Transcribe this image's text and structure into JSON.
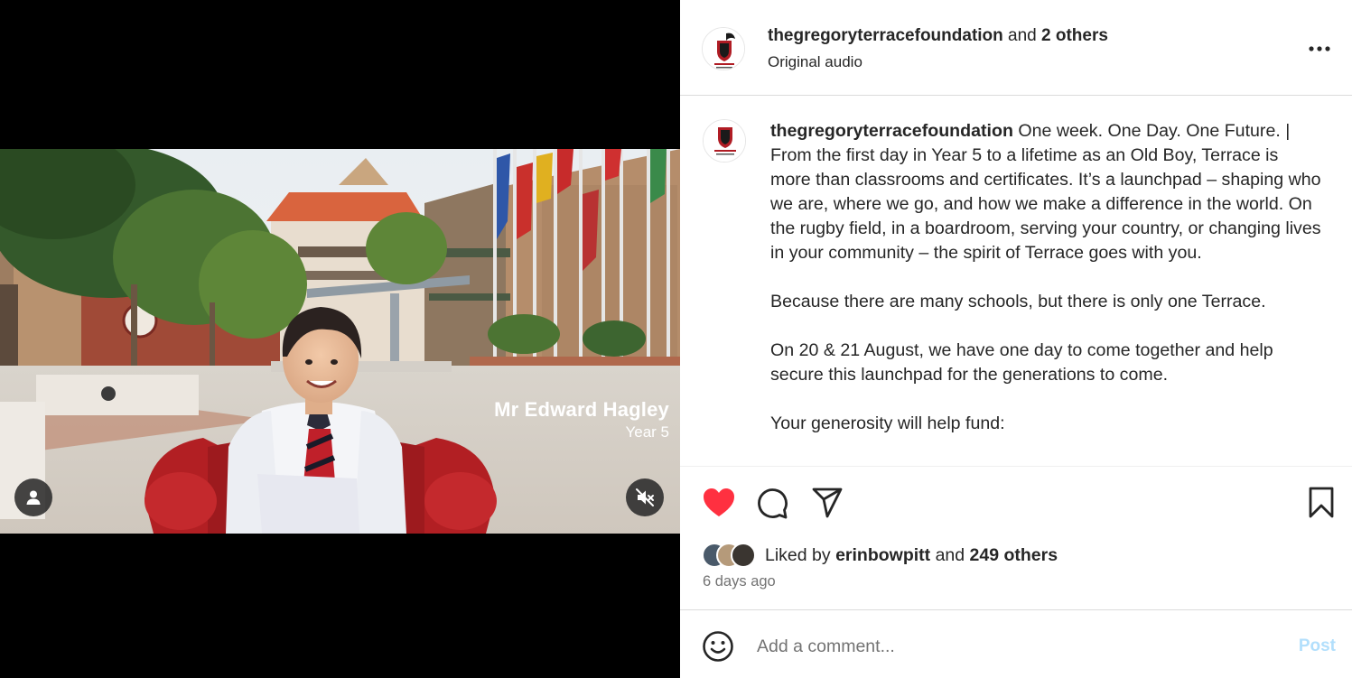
{
  "video": {
    "lower_third_name": "Mr Edward Hagley",
    "lower_third_subtitle": "Year 5",
    "tag_users_icon": "user-icon",
    "mute_icon": "muted-speaker-icon"
  },
  "header": {
    "username": "thegregoryterracefoundation",
    "connector": "and",
    "others": "2 others",
    "audio": "Original audio",
    "more_icon": "more-horizontal-icon",
    "more_label": "•••"
  },
  "caption": {
    "username": "thegregoryterracefoundation",
    "paragraph1": "One week. One Day. One Future. | From the first day in Year 5 to a lifetime as an Old Boy, Terrace is more than classrooms and certificates. It’s a launchpad – shaping who we are, where we go, and how we make a difference in the world. On the rugby field, in a boardroom, serving your country, or changing lives in your community – the spirit of Terrace goes with you.",
    "paragraph2": "Because there are many schools, but there is only one Terrace.",
    "paragraph3": "On 20 & 21 August, we have one day to come together and help secure this launchpad for the generations to come.",
    "paragraph4": "Your generosity will help fund:"
  },
  "actions": {
    "like_icon": "heart-filled-icon",
    "comment_icon": "comment-icon",
    "share_icon": "share-icon",
    "save_icon": "bookmark-icon",
    "like_color": "#ff3040"
  },
  "likes": {
    "prefix": "Liked by",
    "user": "erinbowpitt",
    "connector": "and",
    "others": "249 others"
  },
  "timestamp": "6 days ago",
  "comment": {
    "emoji_icon": "smiley-icon",
    "placeholder": "Add a comment...",
    "post_label": "Post",
    "post_color": "#b2dffc"
  }
}
